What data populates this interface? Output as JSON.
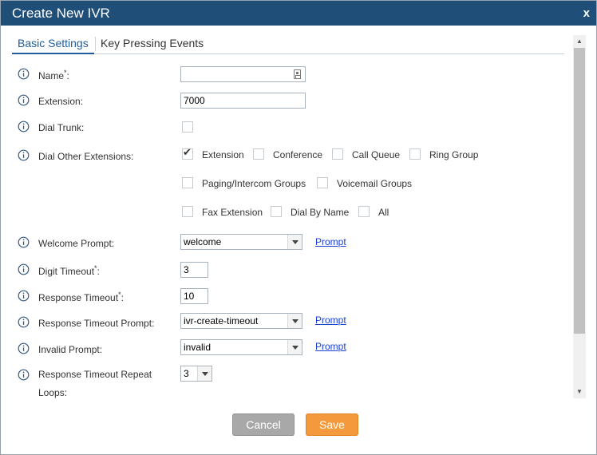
{
  "dialog": {
    "title": "Create New IVR",
    "close_label": "x"
  },
  "tabs": {
    "basic": "Basic Settings",
    "key_pressing": "Key Pressing Events"
  },
  "fields": {
    "name": {
      "label": "Name",
      "required_mark": "*",
      "suffix": ":",
      "value": ""
    },
    "extension": {
      "label": "Extension:",
      "value": "7000"
    },
    "dial_trunk": {
      "label": "Dial Trunk:",
      "checked": false
    },
    "dial_other_extensions": {
      "label": "Dial Other Extensions:",
      "options": [
        {
          "label": "Extension",
          "checked": true
        },
        {
          "label": "Conference",
          "checked": false
        },
        {
          "label": "Call Queue",
          "checked": false
        },
        {
          "label": "Ring Group",
          "checked": false
        },
        {
          "label": "Paging/Intercom Groups",
          "checked": false
        },
        {
          "label": "Voicemail Groups",
          "checked": false
        },
        {
          "label": "Fax Extension",
          "checked": false
        },
        {
          "label": "Dial By Name",
          "checked": false
        },
        {
          "label": "All",
          "checked": false
        }
      ]
    },
    "welcome_prompt": {
      "label": "Welcome Prompt:",
      "value": "welcome",
      "link": "Prompt"
    },
    "digit_timeout": {
      "label": "Digit Timeout",
      "required_mark": "*",
      "suffix": ":",
      "value": "3"
    },
    "response_timeout": {
      "label": "Response Timeout",
      "required_mark": "*",
      "suffix": ":",
      "value": "10"
    },
    "response_timeout_prompt": {
      "label": "Response Timeout Prompt:",
      "value": "ivr-create-timeout",
      "link": "Prompt"
    },
    "invalid_prompt": {
      "label": "Invalid Prompt:",
      "value": "invalid",
      "link": "Prompt"
    },
    "response_timeout_repeat_loops": {
      "label": "Response Timeout Repeat Loops:",
      "value": "3"
    }
  },
  "buttons": {
    "cancel": "Cancel",
    "save": "Save"
  },
  "colors": {
    "titlebar": "#1f4e79",
    "tab_active": "#1f5c99",
    "save": "#f49a3c",
    "cancel": "#a8a8a8",
    "link": "#1a3fd6"
  }
}
